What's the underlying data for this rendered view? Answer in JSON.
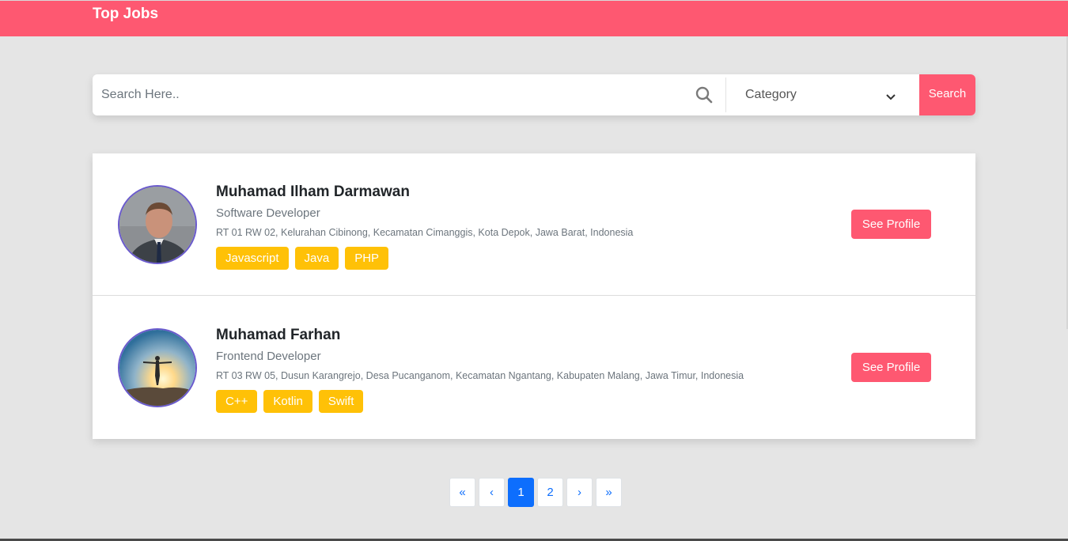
{
  "header": {
    "title": "Top Jobs"
  },
  "search": {
    "placeholder": "Search Here..",
    "category_label": "Category",
    "button_label": "Search"
  },
  "candidates": [
    {
      "name": "Muhamad Ilham Darmawan",
      "role": "Software Developer",
      "address": "RT 01 RW 02, Kelurahan Cibinong, Kecamatan Cimanggis, Kota Depok, Jawa Barat, Indonesia",
      "skills": [
        "Javascript",
        "Java",
        "PHP"
      ],
      "button": "See Profile"
    },
    {
      "name": "Muhamad Farhan",
      "role": "Frontend Developer",
      "address": "RT 03 RW 05, Dusun Karangrejo, Desa Pucanganom, Kecamatan Ngantang, Kabupaten Malang, Jawa Timur, Indonesia",
      "skills": [
        "C++",
        "Kotlin",
        "Swift"
      ],
      "button": "See Profile"
    }
  ],
  "pagination": {
    "first": "«",
    "prev": "‹",
    "pages": [
      "1",
      "2"
    ],
    "active_page": "1",
    "next": "›",
    "last": "»"
  },
  "colors": {
    "brand": "#fe5871",
    "tag": "#ffc107",
    "page_active": "#0d6efd",
    "background": "#e5e5e5"
  }
}
